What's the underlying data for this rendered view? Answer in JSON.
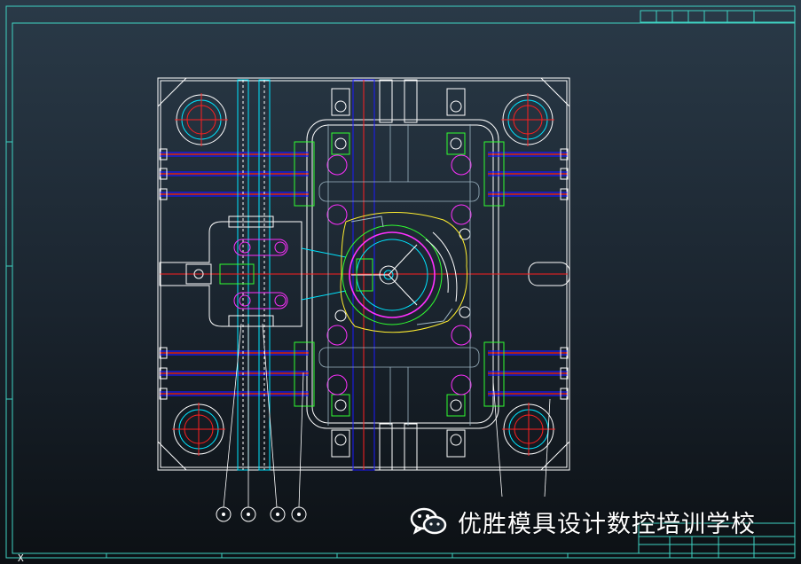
{
  "watermark": {
    "icon": "wechat-icon",
    "text": "优胜模具设计数控培训学校"
  },
  "axis_label": "X",
  "colors": {
    "border": "#3fd3c3",
    "outline": "#ffffff",
    "cyan": "#00e5ff",
    "blue": "#1a1aff",
    "red": "#ff2020",
    "magenta": "#ff30ff",
    "green": "#30ff30",
    "yellow": "#ffee30"
  }
}
